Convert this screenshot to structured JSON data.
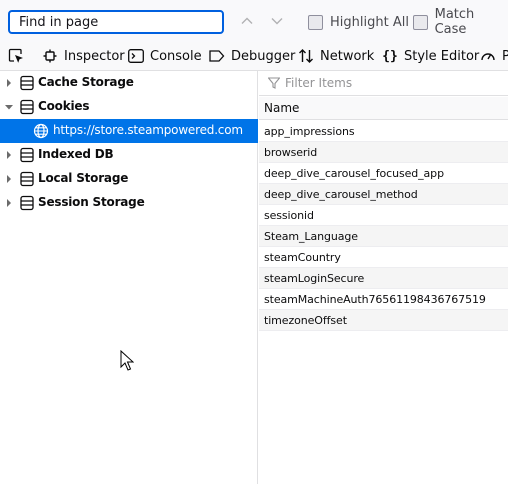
{
  "findbar": {
    "search_placeholder": "Find in page",
    "highlight_all_label": "Highlight All",
    "highlight_all_checked": false,
    "match_case_label": "Match Case",
    "match_case_checked": false
  },
  "toolbar": {
    "tools": [
      {
        "label": "Inspector",
        "icon": "inspector-icon"
      },
      {
        "label": "Console",
        "icon": "console-icon"
      },
      {
        "label": "Debugger",
        "icon": "debugger-icon"
      },
      {
        "label": "Network",
        "icon": "network-icon"
      },
      {
        "label": "Style Editor",
        "icon": "style-editor-icon"
      },
      {
        "label": "P",
        "icon": "performance-icon"
      }
    ]
  },
  "storage_tree": {
    "items": [
      {
        "label": "Cache Storage",
        "icon": "database-icon",
        "expanded": false
      },
      {
        "label": "Cookies",
        "icon": "database-icon",
        "expanded": true
      },
      {
        "label": "https://store.steampowered.com",
        "icon": "globe-icon",
        "selected": true
      },
      {
        "label": "Indexed DB",
        "icon": "database-icon",
        "expanded": false
      },
      {
        "label": "Local Storage",
        "icon": "database-icon",
        "expanded": false
      },
      {
        "label": "Session Storage",
        "icon": "database-icon",
        "expanded": false
      }
    ]
  },
  "cookie_table": {
    "filter_placeholder": "Filter Items",
    "columns": [
      "Name"
    ],
    "rows": [
      "app_impressions",
      "browserid",
      "deep_dive_carousel_focused_app",
      "deep_dive_carousel_method",
      "sessionid",
      "Steam_Language",
      "steamCountry",
      "steamLoginSecure",
      "steamMachineAuth76561198436767519",
      "timezoneOffset"
    ]
  },
  "colors": {
    "accent": "#0074e8",
    "focus_border": "#0060df"
  }
}
